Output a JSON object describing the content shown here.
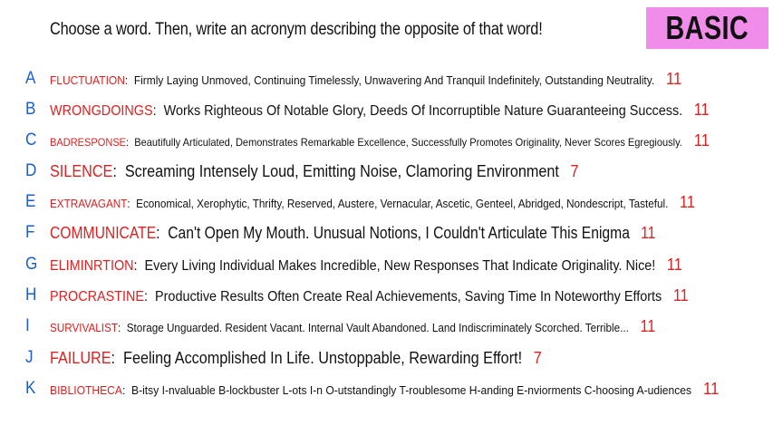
{
  "prompt": "Choose a word. Then, write an acronym describing the opposite of that word!",
  "badge": "BASIC",
  "colors": {
    "badge_bg": "#f08ce9",
    "letter": "#1d5fd0",
    "word": "#e02020",
    "text": "#111111"
  },
  "rows": [
    {
      "letter": "A",
      "word": "FLUCTUATION",
      "desc": "Firmly Laying Unmoved, Continuing Timelessly, Unwavering And Tranquil Indefinitely, Outstanding Neutrality.",
      "score": "11"
    },
    {
      "letter": "B",
      "word": "WRONGDOINGS",
      "desc": "Works Righteous Of Notable Glory, Deeds Of Incorruptible Nature Guaranteeing Success.",
      "score": "11"
    },
    {
      "letter": "C",
      "word": "BADRESPONSE",
      "desc": "Beautifully Articulated, Demonstrates Remarkable Excellence, Successfully Promotes Originality, Never Scores Egregiously.",
      "score": "11"
    },
    {
      "letter": "D",
      "word": "SILENCE",
      "desc": "Screaming Intensely Loud,  Emitting Noise, Clamoring Environment",
      "score": "7"
    },
    {
      "letter": "E",
      "word": "EXTRAVAGANT",
      "desc": "Economical, Xerophytic, Thrifty, Reserved, Austere, Vernacular, Ascetic, Genteel, Abridged, Nondescript, Tasteful.",
      "score": "11"
    },
    {
      "letter": "F",
      "word": "COMMUNICATE",
      "desc": "Can't Open My Mouth. Unusual Notions, I Couldn't Articulate This Enigma",
      "score": "11"
    },
    {
      "letter": "G",
      "word": "ELIMINRTION",
      "desc": "Every Living Individual Makes Incredible, New Responses That Indicate Originality. Nice!",
      "score": "11"
    },
    {
      "letter": "H",
      "word": "PROCRASTINE",
      "desc": "Productive Results Often Create Real Achievements, Saving Time In Noteworthy Efforts",
      "score": "11"
    },
    {
      "letter": "I",
      "word": "SURVIVALIST",
      "desc": "Storage Unguarded. Resident Vacant. Internal Vault Abandoned. Land Indiscriminately Scorched. Terrible...",
      "score": "11"
    },
    {
      "letter": "J",
      "word": "FAILURE",
      "desc": "Feeling Accomplished In Life. Unstoppable, Rewarding Effort!",
      "score": "7"
    },
    {
      "letter": "K",
      "word": "BIBLIOTHECA",
      "desc": "B-itsy I-nvaluable B-lockbuster L-ots I-n O-utstandingly T-roublesome H-anding E-nviorments C-hoosing A-udiences",
      "score": "11"
    }
  ]
}
